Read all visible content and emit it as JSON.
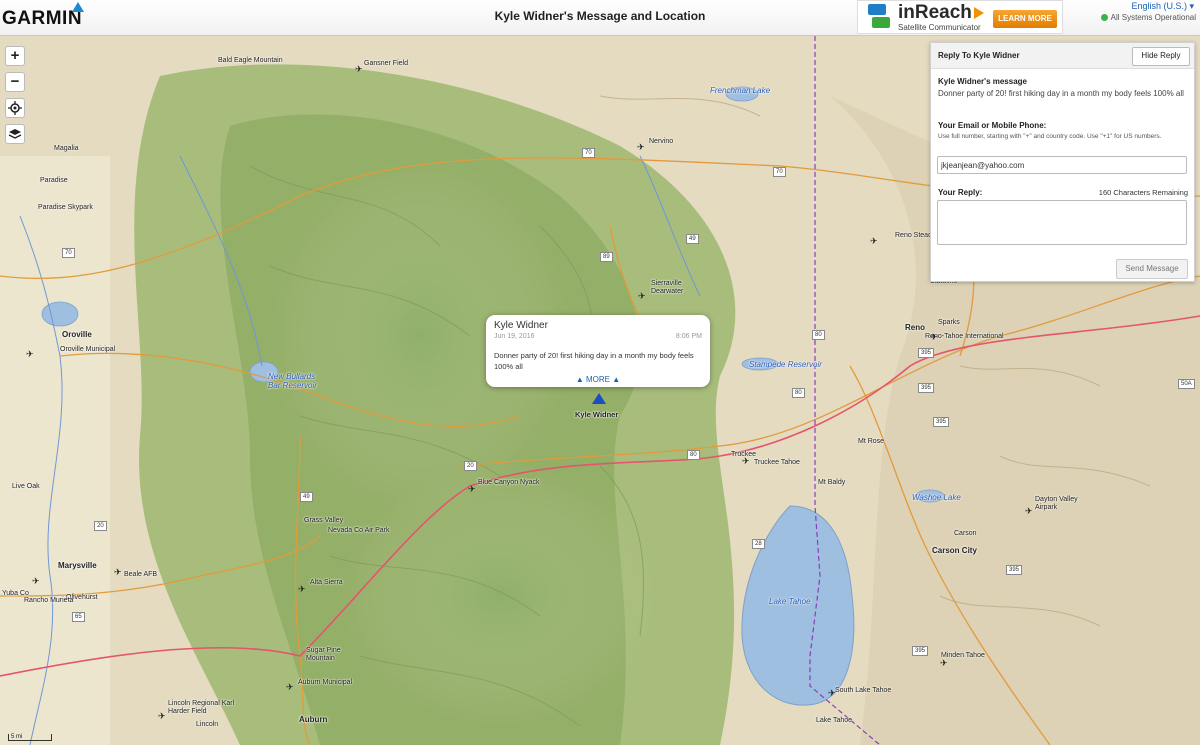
{
  "header": {
    "logo": "GARMIN",
    "title": "Kyle Widner's Message and Location",
    "ad_brand": "inReach",
    "ad_tagline": "Satellite Communicator",
    "ad_button": "LEARN MORE",
    "language": "English (U.S.) ▾",
    "status": "All Systems Operational"
  },
  "colors": {
    "status_ok": "#3bb34a",
    "link": "#1b62b3",
    "ad_button": "#f39200",
    "marker": "#1e4cc4"
  },
  "map_controls": {
    "zoom_in": "+",
    "zoom_out": "−",
    "locate_icon": "crosshair-icon",
    "layers_icon": "layers-icon",
    "scale": "5 mi"
  },
  "popup": {
    "name": "Kyle Widner",
    "date": "Jun 19, 2016",
    "time": "8:06 PM",
    "message": "Donner party of 20! first hiking day in a month my body feels 100% all",
    "more": "▲ MORE ▲"
  },
  "marker_label": "Kyle Widner",
  "reply_panel": {
    "title": "Reply To Kyle Widner",
    "hide_button": "Hide Reply",
    "message_label": "Kyle Widner's message",
    "message": "Donner party of 20! first hiking day in a month my body feels 100% all",
    "contact_label": "Your Email or Mobile Phone:",
    "contact_hint": "Use full number, starting with \"+\" and country code. Use \"+1\" for US numbers.",
    "contact_value": "jkjeanjean@yahoo.com",
    "reply_label": "Your Reply:",
    "remaining": "160 Characters Remaining",
    "send_button": "Send Message"
  },
  "places": [
    "Bald Eagle Mountain",
    "Gansner Field",
    "Frenchman Lake",
    "Nervino",
    "Magalia",
    "Paradise",
    "Paradise Skypark",
    "Reno Stead",
    "Oroville",
    "Oroville Municipal",
    "Stampede Reservoir",
    "Reno",
    "Sparks",
    "Reno-Tahoe International",
    "New Bullards Bar Reservoir",
    "Truckee",
    "Truckee Tahoe",
    "Mt Rose",
    "Live Oak",
    "Blue Canyon Nyack",
    "Mt Baldy",
    "Washoe Lake",
    "Dayton Valley Airpark",
    "Grass Valley",
    "Nevada Co Air Park",
    "Carson",
    "Carson City",
    "Marysville",
    "Beale AFB",
    "Olivehurst",
    "Alta Sierra",
    "Lake Tahoe",
    "Minden Tahoe",
    "Sugar Pine Mountain",
    "Auburn Municipal",
    "South Lake Tahoe",
    "Lake Tahoe",
    "Lincoln Regional Karl Harder Field",
    "Lincoln",
    "Auburn",
    "Stateline",
    "Sierraville Dearwater",
    "Yuba Co",
    "Rancho Murieta"
  ],
  "routes": [
    "70",
    "70",
    "70",
    "49",
    "89",
    "20",
    "80",
    "80",
    "80",
    "49",
    "20",
    "65",
    "28",
    "395",
    "395",
    "395",
    "395",
    "580",
    "50A",
    "395"
  ]
}
